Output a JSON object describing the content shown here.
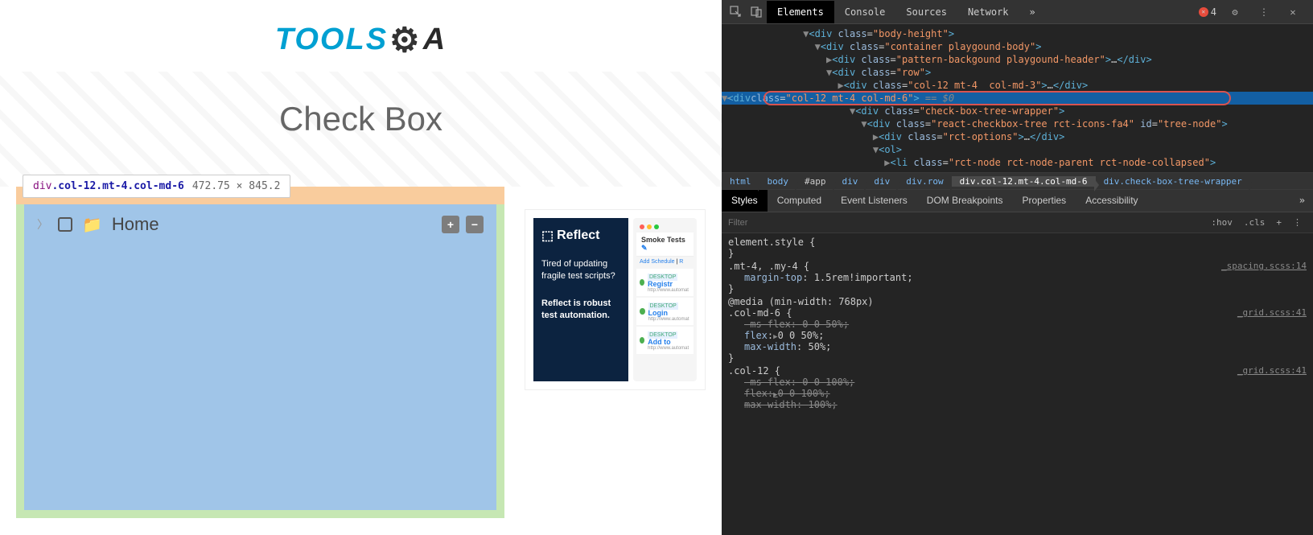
{
  "page": {
    "logo": {
      "tools": "TOOLS",
      "qa": "A"
    },
    "title": "Check Box",
    "tooltip": {
      "tag": "div",
      "classes": ".col-12.mt-4.col-md-6",
      "dims": "472.75 × 845.2"
    },
    "tree": {
      "home": "Home"
    },
    "ad": {
      "logo": "Reflect",
      "text1": "Tired of updating fragile test scripts?",
      "text2": "Reflect is robust test automation.",
      "header": "Smoke Tests",
      "addSchedule": "Add Schedule",
      "items": [
        {
          "badge": "DESKTOP",
          "name": "Registr",
          "url": "http://www.automat"
        },
        {
          "badge": "DESKTOP",
          "name": "Login",
          "url": "http://www.automat"
        },
        {
          "badge": "DESKTOP",
          "name": "Add to",
          "url": "http://www.automat"
        }
      ]
    }
  },
  "devtools": {
    "tabs": [
      "Elements",
      "Console",
      "Sources",
      "Network"
    ],
    "activeTab": "Elements",
    "errorCount": "4",
    "dom": {
      "l1": {
        "cls": "body-height"
      },
      "l2": {
        "cls": "container playgound-body"
      },
      "l3": {
        "cls": "pattern-backgound playgound-header"
      },
      "l4": {
        "cls": "row"
      },
      "l5": {
        "cls": "col-12 mt-4  col-md-3"
      },
      "l6": {
        "cls": "col-12 mt-4 col-md-6",
        "suffix": " == $0"
      },
      "l7": {
        "cls": "check-box-tree-wrapper"
      },
      "l8": {
        "cls": "react-checkbox-tree rct-icons-fa4",
        "id": "tree-node"
      },
      "l9": {
        "cls": "rct-options"
      },
      "l10": {
        "tag": "ol"
      },
      "l11": {
        "cls": "rct-node rct-node-parent rct-node-collapsed"
      }
    },
    "crumbs": [
      "html",
      "body",
      "#app",
      "div",
      "div",
      "div.row",
      "div.col-12.mt-4.col-md-6",
      "div.check-box-tree-wrapper"
    ],
    "stylesTabs": [
      "Styles",
      "Computed",
      "Event Listeners",
      "DOM Breakpoints",
      "Properties",
      "Accessibility"
    ],
    "filterPlaceholder": "Filter",
    "hovLabel": ":hov",
    "clsLabel": ".cls",
    "rules": {
      "r0": {
        "sel": "element.style {",
        "close": "}"
      },
      "r1": {
        "sel": ".mt-4, .my-4 {",
        "src": "_spacing.scss:14",
        "p1n": "margin-top",
        "p1v": "1.5rem",
        "p1i": "!important",
        "close": "}"
      },
      "r2": {
        "media": "@media (min-width: 768px)",
        "sel": ".col-md-6 {",
        "src": "_grid.scss:41",
        "p1n": "-ms-flex",
        "p1v": "0 0 50%",
        "p2n": "flex",
        "p2v": "0 0 50%",
        "p3n": "max-width",
        "p3v": "50%",
        "close": "}"
      },
      "r3": {
        "sel": ".col-12 {",
        "src": "_grid.scss:41",
        "p1n": "-ms-flex",
        "p1v": "0 0 100%",
        "p2n": "flex",
        "p2v": "0 0 100%",
        "p3n": "max-width",
        "p3v": "100%"
      }
    }
  }
}
